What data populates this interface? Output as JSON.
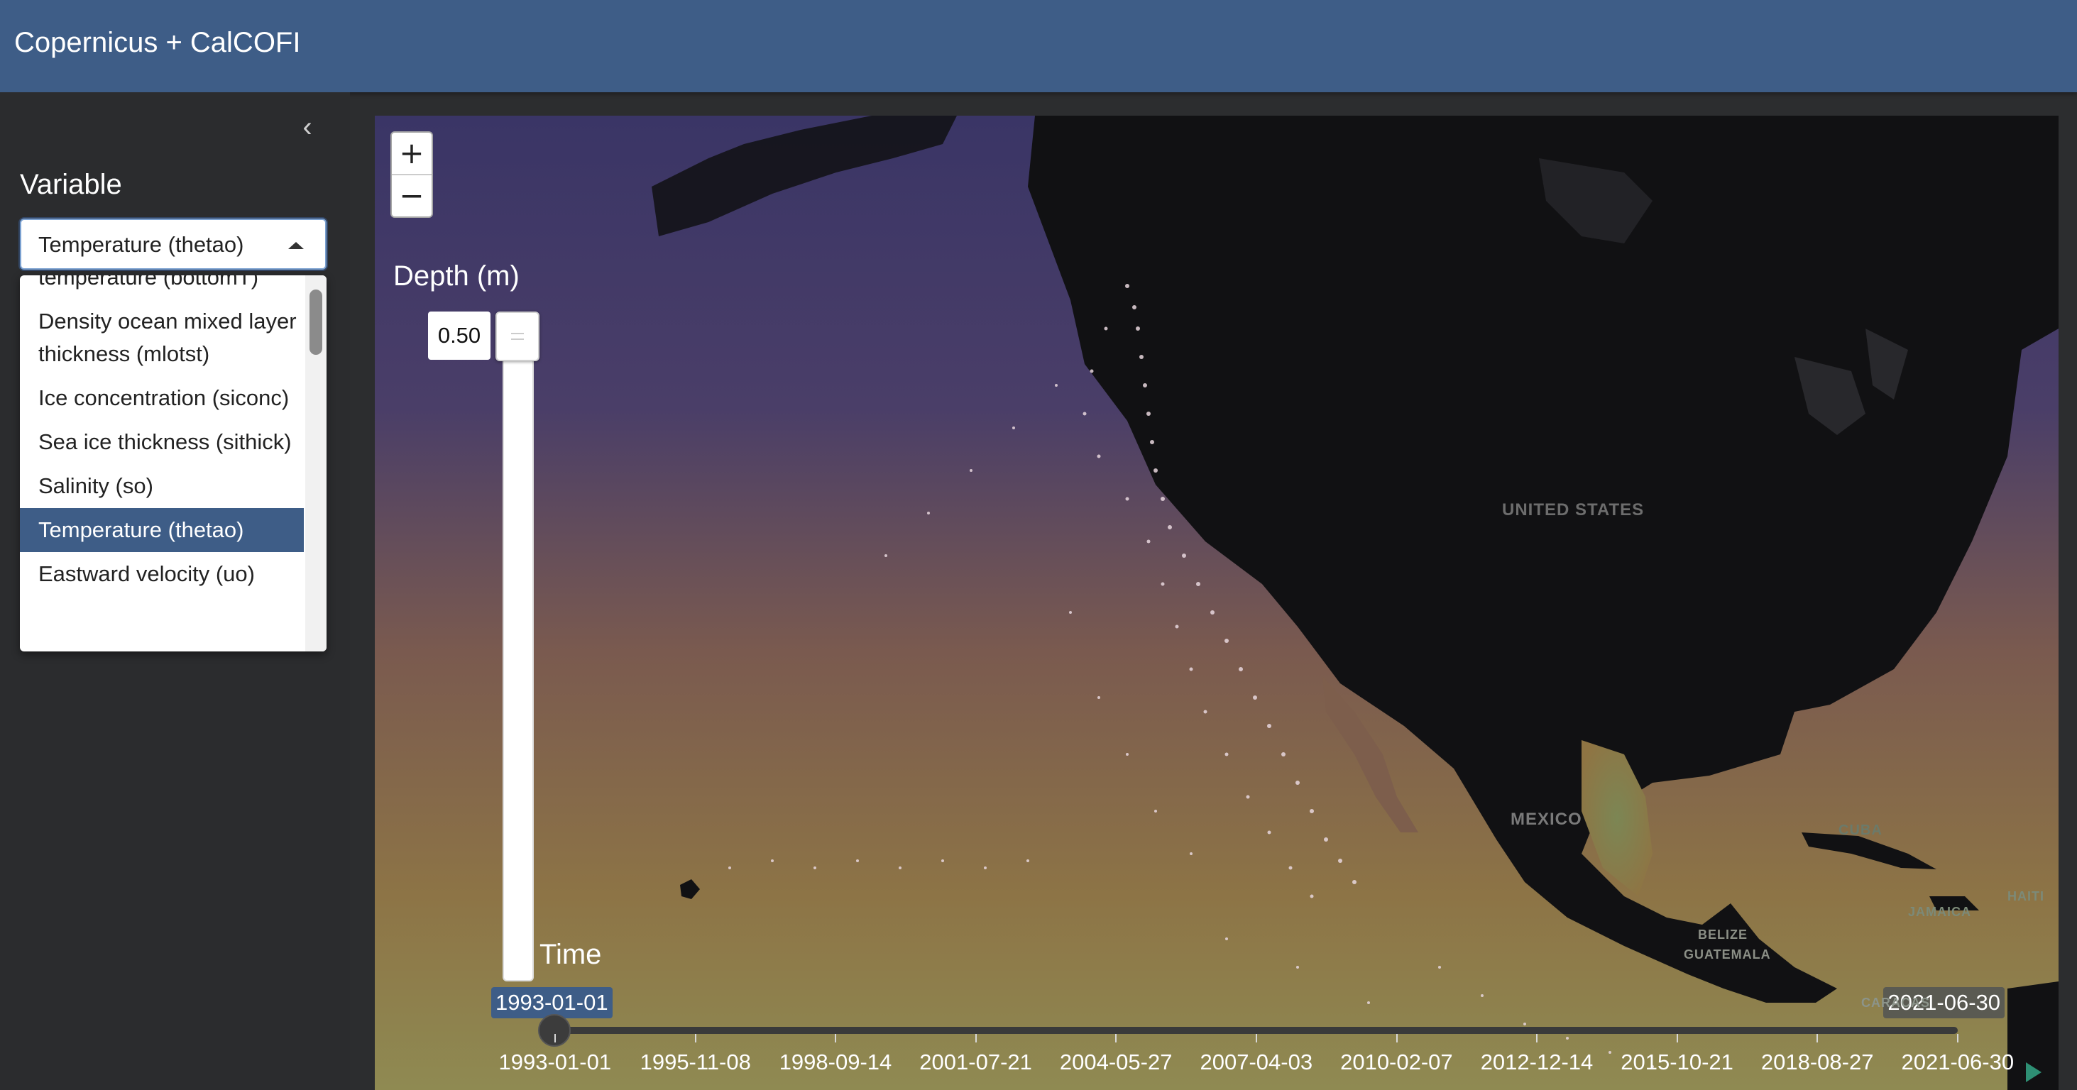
{
  "app": {
    "title": "Copernicus + CalCOFI"
  },
  "sidebar": {
    "collapse_icon": "chevron-left-icon",
    "variable_label": "Variable",
    "select_value": "Temperature (thetao)",
    "options": [
      "temperature (bottomT)",
      "Density ocean mixed layer thickness (mlotst)",
      "Ice concentration (siconc)",
      "Sea ice thickness (sithick)",
      "Salinity (so)",
      "Temperature (thetao)",
      "Eastward velocity (uo)"
    ],
    "selected_option": "Temperature (thetao)"
  },
  "map": {
    "zoom_in": "+",
    "zoom_out": "−",
    "depth": {
      "label": "Depth (m)",
      "value": "0.50"
    },
    "time": {
      "label": "Time",
      "from": "1993-01-01",
      "to": "2021-06-30",
      "ticks": [
        "1993-01-01",
        "1995-11-08",
        "1998-09-14",
        "2001-07-21",
        "2004-05-27",
        "2007-04-03",
        "2010-02-07",
        "2012-12-14",
        "2015-10-21",
        "2018-08-27",
        "2021-06-30"
      ]
    },
    "places": {
      "us": "UNITED STATES",
      "mexico": "MEXICO",
      "cuba": "CUBA",
      "belize": "BELIZE",
      "guatemala": "GUATEMALA",
      "jamaica": "JAMAICA",
      "haiti": "HAITI",
      "caracas": "CARACAS"
    },
    "colors": {
      "ocean_north": "#3b3663",
      "ocean_south": "#8a7a4a",
      "land": "#121214",
      "accent": "#3e5d87"
    }
  }
}
